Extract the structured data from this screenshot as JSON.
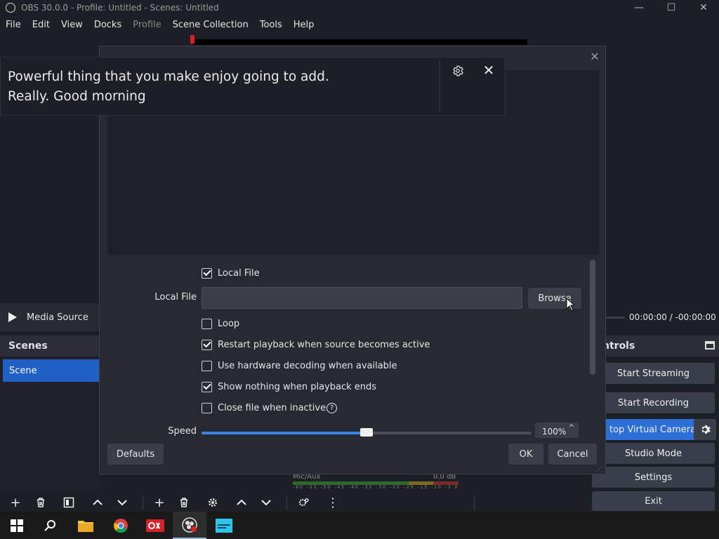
{
  "window": {
    "title": "OBS 30.0.0 - Profile: Untitled - Scenes: Untitled",
    "minimize": "—",
    "maximize": "☐",
    "close": "✕"
  },
  "menu": [
    "File",
    "Edit",
    "View",
    "Docks",
    "Profile",
    "Scene Collection",
    "Tools",
    "Help"
  ],
  "media": {
    "source_label": "Media Source",
    "time": "00:00:00  /  -00:00:00"
  },
  "scenes": {
    "header": "Scenes",
    "items": [
      "Scene"
    ]
  },
  "controls": {
    "header": "ntrols",
    "start_streaming": "Start Streaming",
    "start_recording": "Start Recording",
    "virtual_camera": "top Virtual Camera",
    "studio_mode": "Studio Mode",
    "settings": "Settings",
    "exit": "Exit"
  },
  "audio": {
    "mixer_label": "Mic/Aux",
    "db": "0.0 dB",
    "ticks": "-60 -55 -50 -45 -40 -35 -30 -25 -20 -15 -10 -5 0"
  },
  "notification": {
    "line1": "Powerful thing that you make enjoy going to add.",
    "line2": "Really. Good morning"
  },
  "dialog": {
    "close": "✕",
    "local_file_checkbox": "Local File",
    "local_file_label": "Local File",
    "local_file_value": "",
    "browse": "Browse",
    "loop": "Loop",
    "restart": "Restart playback when source becomes active",
    "hw_decoding": "Use hardware decoding when available",
    "show_nothing": "Show nothing when playback ends",
    "close_inactive": "Close file when inactive",
    "help": "?",
    "speed_label": "Speed",
    "speed_value": "100%",
    "speed_fraction": 0.5,
    "defaults": "Defaults",
    "ok": "OK",
    "cancel": "Cancel",
    "checks": {
      "local_file": true,
      "loop": false,
      "restart": true,
      "hw_decoding": false,
      "show_nothing": true,
      "close_inactive": false
    }
  },
  "taskbar": {
    "icons": [
      "windows-start-icon",
      "search-icon",
      "file-explorer-icon",
      "chrome-icon",
      "recorder-app-icon",
      "obs-icon",
      "notes-app-icon"
    ]
  },
  "colors": {
    "accent": "#1f5fc6",
    "slider": "#3a86e6",
    "background": "#1d1f26",
    "panel": "#272a33"
  }
}
